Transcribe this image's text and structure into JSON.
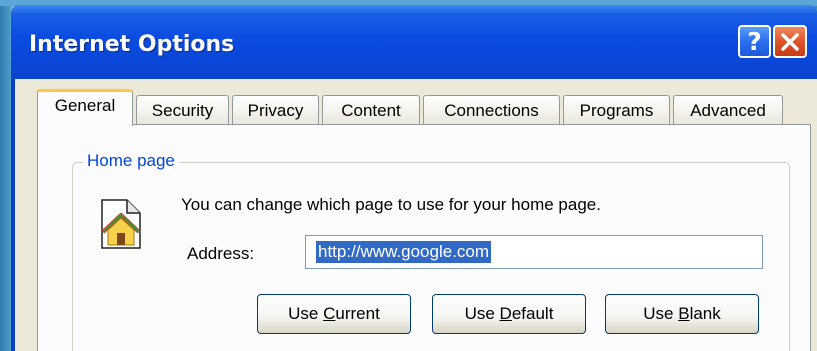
{
  "window": {
    "title": "Internet Options",
    "help_glyph": "?"
  },
  "tabs": [
    {
      "label": "General",
      "active": true
    },
    {
      "label": "Security",
      "active": false
    },
    {
      "label": "Privacy",
      "active": false
    },
    {
      "label": "Content",
      "active": false
    },
    {
      "label": "Connections",
      "active": false
    },
    {
      "label": "Programs",
      "active": false
    },
    {
      "label": "Advanced",
      "active": false
    }
  ],
  "home_page": {
    "group_title": "Home page",
    "description": "You can change which page to use for your home page.",
    "address_label": "Address:",
    "address_value": "http://www.google.com",
    "icon": "home-page-icon"
  },
  "buttons": {
    "use_current": {
      "label": "Use Current",
      "pre": "Use ",
      "mnemonic": "C",
      "post": "urrent"
    },
    "use_default": {
      "label": "Use Default",
      "pre": "Use ",
      "mnemonic": "D",
      "post": "efault"
    },
    "use_blank": {
      "label": "Use Blank",
      "pre": "Use ",
      "mnemonic": "B",
      "post": "lank"
    }
  },
  "colors": {
    "titlebar": "#0b4be0",
    "dialog_background": "#ece9d8",
    "selection": "#316ac5",
    "group_title": "#0046d5",
    "active_tab_highlight": "#ffc83c",
    "close_button": "#e0542a"
  }
}
